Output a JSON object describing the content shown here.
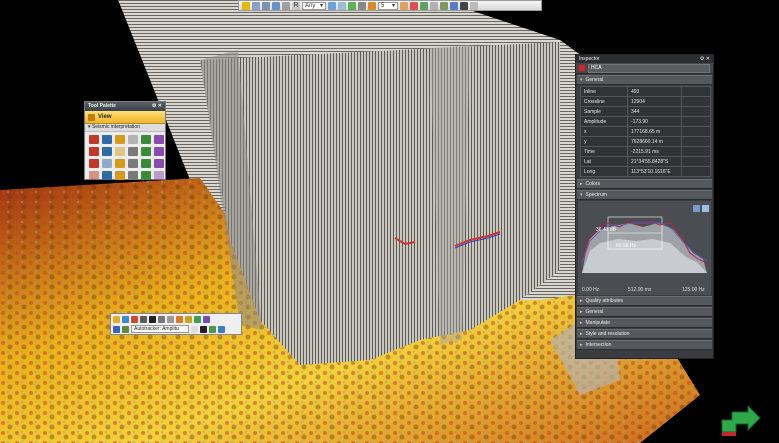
{
  "toolbar": {
    "depth_mode": "Any",
    "count_value": "5"
  },
  "tool_palette": {
    "title": "Tool Palette",
    "view_label": "View",
    "section_label": "Seismic interpretation",
    "icons": [
      "pick-icon",
      "inline-icon",
      "crossline-icon",
      "zslice-icon",
      "select-icon",
      "grid-icon",
      "pen-icon",
      "curve-icon",
      "paint-icon",
      "eraser-icon",
      "magnet-icon",
      "anchor-icon",
      "vertex-icon",
      "move-icon",
      "rotate-icon",
      "undo-icon",
      "redo-icon",
      "delete-icon",
      "flag-icon",
      "target-icon",
      "refresh-icon",
      "lasso-icon",
      "ruler-icon",
      "settings-icon"
    ]
  },
  "inline_toolbar": {
    "autotracker_mode": "Autotracker: Amplitu"
  },
  "inspector": {
    "title": "Inspector",
    "object": "HCA",
    "general_label": "General",
    "properties": [
      {
        "key": "Inline",
        "value": "493"
      },
      {
        "key": "Crossline",
        "value": "12904"
      },
      {
        "key": "Sample",
        "value": "344"
      },
      {
        "key": "Amplitude",
        "value": "-173.90"
      },
      {
        "key": "x",
        "value": "177168.65 m"
      },
      {
        "key": "y",
        "value": "7628660.14 m"
      },
      {
        "key": "Time",
        "value": "-2215.91 ms"
      },
      {
        "key": "Lat",
        "value": "21°34'55.8428\"S"
      },
      {
        "key": "Long",
        "value": "113°53'10.1616\"E"
      }
    ],
    "colors_label": "Colors",
    "spectrum_label": "Spectrum",
    "spectrum_db": "36.47 dB",
    "spectrum_hz": "60.58 Hz",
    "x_ticks": [
      "0.00 Hz",
      "512.00 ms",
      "125.00 Hz"
    ],
    "bottom_sections": [
      "Quality attributes",
      "General",
      "Manipulate",
      "Style and resolution",
      "Intersection"
    ]
  },
  "colors": {
    "accent": "#f0b52a",
    "panel": "#3a3c40",
    "spectrum_red": "#c0203a",
    "spectrum_blue": "#5060d0",
    "nav_green": "#2fa84a"
  }
}
